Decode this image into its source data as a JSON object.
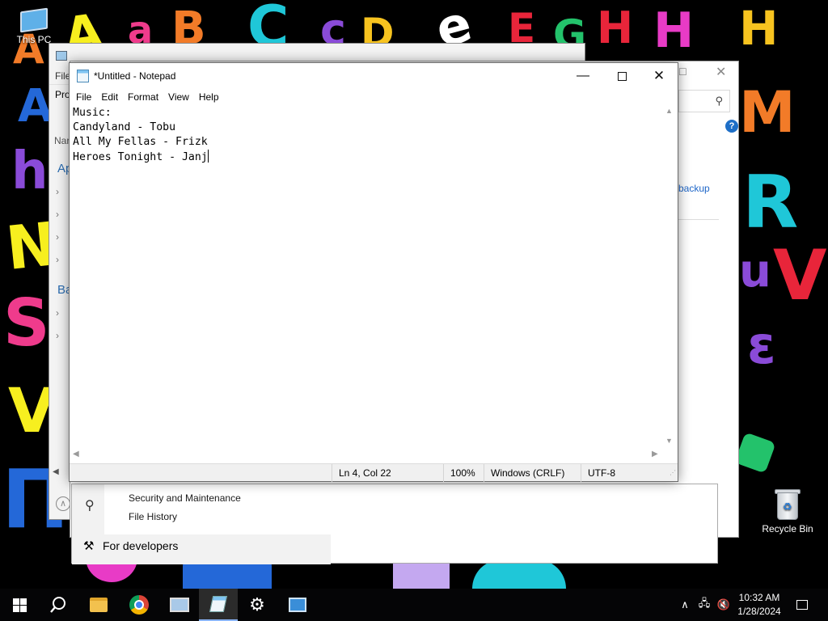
{
  "desktop": {
    "this_pc_label": "This PC",
    "recycle_bin_label": "Recycle Bin"
  },
  "wallpaper_letters": [
    {
      "ch": "A",
      "color": "#f7ef1f"
    },
    {
      "ch": "a",
      "color": "#ef3b8c"
    },
    {
      "ch": "B",
      "color": "#f27b28"
    },
    {
      "ch": "C",
      "color": "#1fc7d8"
    },
    {
      "ch": "c",
      "color": "#8a4bd8"
    },
    {
      "ch": "D",
      "color": "#f7c31f"
    },
    {
      "ch": "e",
      "color": "#ffffff"
    },
    {
      "ch": "E",
      "color": "#e8253a"
    },
    {
      "ch": "G",
      "color": "#23c26b"
    },
    {
      "ch": "H",
      "color": "#e8253a"
    },
    {
      "ch": "H",
      "color": "#e83bc6"
    },
    {
      "ch": "H",
      "color": "#f7c31f"
    },
    {
      "ch": "A",
      "color": "#2468d8"
    },
    {
      "ch": "h",
      "color": "#8a4bd8"
    },
    {
      "ch": "N",
      "color": "#f7ef1f"
    },
    {
      "ch": "S",
      "color": "#ef3b8c"
    },
    {
      "ch": "V",
      "color": "#f7ef1f"
    },
    {
      "ch": "П",
      "color": "#2468d8"
    },
    {
      "ch": "M",
      "color": "#f27b28"
    },
    {
      "ch": "R",
      "color": "#1fc7d8"
    },
    {
      "ch": "u",
      "color": "#8a4bd8"
    },
    {
      "ch": "V",
      "color": "#e8253a"
    },
    {
      "ch": "ε",
      "color": "#8a4bd8"
    },
    {
      "ch": "A",
      "color": "#f27b28"
    }
  ],
  "back_window": {
    "menu_file": "File",
    "menu_prop": "Pro",
    "col_name": "Nar",
    "section_ap": "Ap",
    "section_ba": "Ba",
    "backup_link": "backup",
    "help_icon": "help-circle-icon"
  },
  "settings": {
    "link_security": "Security and Maintenance",
    "link_file_history": "File History",
    "for_developers": "For developers"
  },
  "notepad": {
    "title": "*Untitled - Notepad",
    "menu": [
      "File",
      "Edit",
      "Format",
      "View",
      "Help"
    ],
    "lines": [
      "Music:",
      "Candyland - Tobu",
      "All My Fellas - Frizk",
      "Heroes Tonight - Janj"
    ],
    "status": {
      "position": "Ln 4, Col 22",
      "zoom": "100%",
      "line_ending": "Windows (CRLF)",
      "encoding": "UTF-8"
    }
  },
  "taskbar": {
    "apps": [
      "start-icon",
      "search-icon",
      "file-explorer-icon",
      "chrome-icon",
      "network-computer-icon",
      "notepad-icon",
      "settings-icon",
      "control-panel-icon"
    ],
    "time": "10:32 AM",
    "date": "1/28/2024"
  }
}
